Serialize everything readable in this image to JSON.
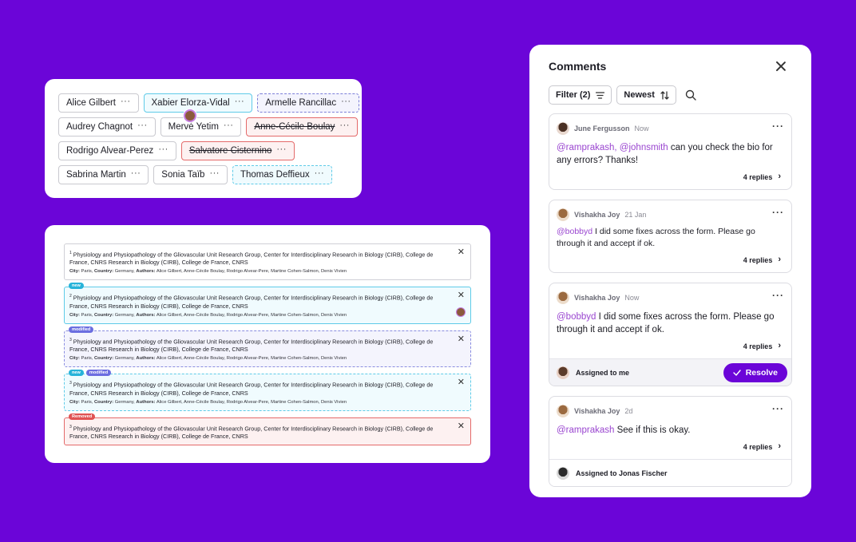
{
  "authors": {
    "rows": [
      [
        {
          "name": "Alice Gilbert",
          "state": "default"
        },
        {
          "name": "Xabier Elorza-Vidal",
          "state": "new"
        },
        {
          "name": "Armelle Rancillac",
          "state": "modified"
        }
      ],
      [
        {
          "name": "Audrey Chagnot",
          "state": "default"
        },
        {
          "name": "Mervé Yetim",
          "state": "default",
          "cursor": true
        },
        {
          "name": "Anne-Cécile Boulay",
          "state": "removed"
        }
      ],
      [
        {
          "name": "Rodrigo Alvear-Perez",
          "state": "default"
        },
        {
          "name": "Salvatore Cisternino",
          "state": "removed"
        }
      ],
      [
        {
          "name": "Sabrina Martin",
          "state": "default"
        },
        {
          "name": "Sonia Taïb",
          "state": "default"
        },
        {
          "name": "Thomas Deffieux",
          "state": "dashed-new"
        }
      ]
    ],
    "more_symbol": "···"
  },
  "affiliations": {
    "items": [
      {
        "state": "default",
        "tags": [],
        "sup": "1",
        "text": "Physiology and Physiopathology of the Gliovascular Unit Research Group, Center for Interdisciplinary Research in Biology (CIRB), College de France, CNRS Research in Biology (CIRB), College de France, CNRS",
        "city": "Paris",
        "country": "Germany",
        "authors": "Alice Gilbert, Anne-Cécile Boulay, Rodrigo Alvear-Pere, Martine Cohen-Salmon, Denis Vivien"
      },
      {
        "state": "new",
        "tags": [
          "new"
        ],
        "sup": "2",
        "text": "Physiology and Physiopathology of the Gliovascular Unit Research Group, Center for Interdisciplinary Research in Biology (CIRB), College de France, CNRS Research in Biology (CIRB), College de France, CNRS",
        "city": "Paris",
        "country": "Germany",
        "authors": "Alice Gilbert, Anne-Cécile Boulay, Rodrigo Alvear-Pere, Martine Cohen-Salmon, Denis Vivien"
      },
      {
        "state": "modified",
        "tags": [
          "modified"
        ],
        "sup": "3",
        "text": "Physiology and Physiopathology of the Gliovascular Unit Research Group, Center for Interdisciplinary Research in Biology (CIRB), College de France, CNRS Research in Biology (CIRB), College de France, CNRS",
        "city": "Paris",
        "country": "Germany",
        "authors": "Alice Gilbert, Anne-Cécile Boulay, Rodrigo Alvear-Pere, Martine Cohen-Salmon, Denis Vivien"
      },
      {
        "state": "both",
        "tags": [
          "new",
          "modified"
        ],
        "sup": "3",
        "text": "Physiology and Physiopathology of the Gliovascular Unit Research Group, Center for Interdisciplinary Research in Biology (CIRB), College de France, CNRS Research in Biology (CIRB), College de France, CNRS",
        "city": "Paris",
        "country": "Germany",
        "authors": "Alice Gilbert, Anne-Cécile Boulay, Rodrigo Alvear-Pere, Martine Cohen-Salmon, Denis Vivien"
      },
      {
        "state": "removed",
        "tags": [
          "Removed"
        ],
        "sup": "3",
        "text": "Physiology and Physiopathology of the Gliovascular Unit Research Group, Center for Interdisciplinary Research in Biology (CIRB), College de France, CNRS Research in Biology (CIRB), College de France, CNRS",
        "city": "",
        "country": "",
        "authors": ""
      }
    ],
    "labels": {
      "city": "City:",
      "country": "Country:",
      "authors": "Authors:"
    },
    "close_symbol": "✕"
  },
  "comments": {
    "title": "Comments",
    "filter_label": "Filter (2)",
    "sort_label": "Newest",
    "items": [
      {
        "author": "June Fergusson",
        "time": "Now",
        "avatar": "a1",
        "mentions": [
          "@ramprakash,",
          "@johnsmith"
        ],
        "text": " can you check the bio for any errors? Thanks!",
        "replies": "4 replies",
        "size": "large"
      },
      {
        "author": "Vishakha Joy",
        "time": "21 Jan",
        "avatar": "a2",
        "mentions": [
          "@bobbyd"
        ],
        "text": " I did some fixes across the form. Please go through it and accept if ok.",
        "replies": "4 replies",
        "size": "small"
      },
      {
        "author": "Vishakha Joy",
        "time": "Now",
        "avatar": "a2",
        "mentions": [
          "@bobbyd"
        ],
        "text": " I did some fixes across the form. Please go through it and accept if ok.",
        "replies": "4 replies",
        "size": "large",
        "assignment": {
          "label": "Assigned to me",
          "action": "Resolve",
          "avatar": "a3"
        }
      },
      {
        "author": "Vishakha Joy",
        "time": "2d",
        "avatar": "a2",
        "mentions": [
          "@ramprakash"
        ],
        "text": " See if this is okay.",
        "replies": "4 replies",
        "size": "large",
        "assignment": {
          "label": "Assigned to Jonas Fischer",
          "avatar": "a4"
        }
      }
    ],
    "more_symbol": "···",
    "chevron_symbol": "›"
  },
  "colors": {
    "background": "#6b05d8",
    "accent": "#6b05d8",
    "mention": "#9a46d0",
    "new": "#5fcbe8",
    "modified": "#7c7fd8",
    "removed": "#e46a6a"
  },
  "icons": {
    "close": "close-icon",
    "filter": "filter-icon",
    "sort": "sort-icon",
    "search": "search-icon",
    "check": "check-icon"
  }
}
